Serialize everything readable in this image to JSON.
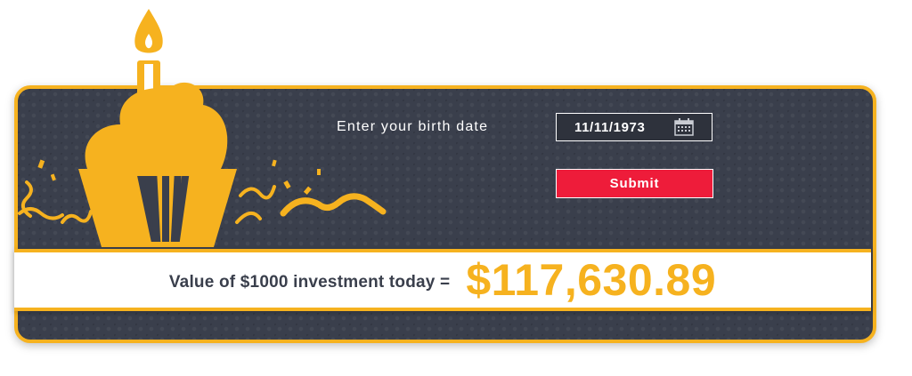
{
  "form": {
    "birth_label": "Enter your birth date",
    "birth_date_value": "11/11/1973",
    "submit_label": "Submit"
  },
  "result": {
    "label": "Value of $1000 investment today =",
    "value": "$117,630.89"
  },
  "colors": {
    "card_bg": "#3a3f4c",
    "accent": "#f6b21f",
    "submit": "#ee1c3a"
  },
  "icons": {
    "calendar": "calendar-icon",
    "cupcake": "cupcake-icon",
    "candle": "candle-icon"
  }
}
